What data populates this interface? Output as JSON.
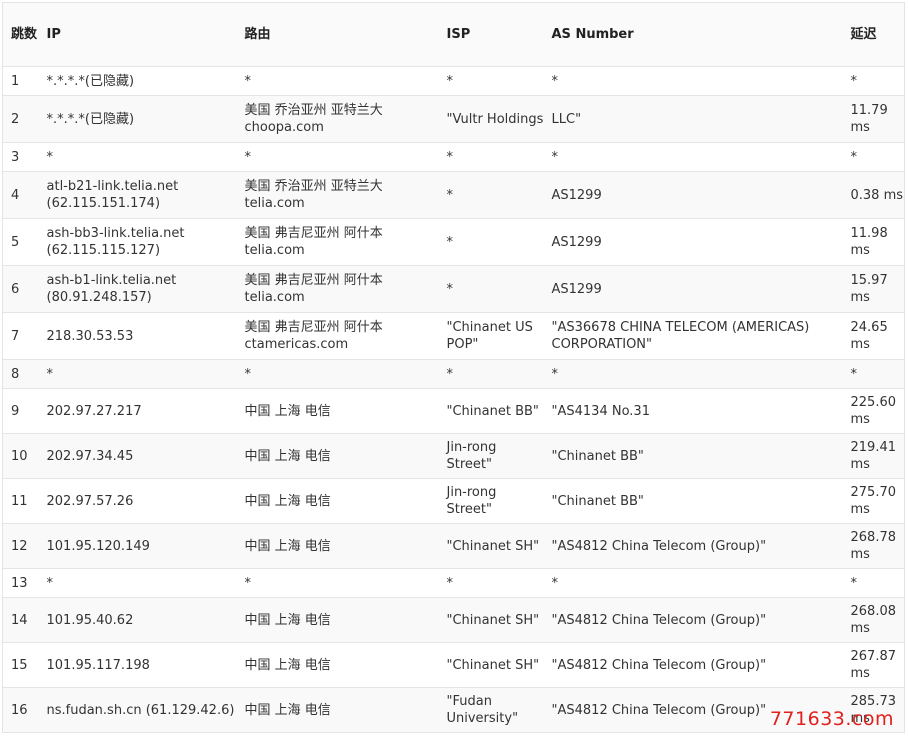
{
  "headers": {
    "hop": "跳数",
    "ip": "IP",
    "route": "路由",
    "isp": "ISP",
    "as": "AS Number",
    "latency": "延迟"
  },
  "rows": [
    {
      "hop": "1",
      "ip": "*.*.*.*(已隐藏)",
      "route": "*",
      "isp": "*",
      "as": "*",
      "latency": "*"
    },
    {
      "hop": "2",
      "ip": "*.*.*.*(已隐藏)",
      "route": "美国 乔治亚州 亚特兰大 choopa.com",
      "isp": "\"Vultr Holdings",
      "as": "LLC\"",
      "latency": "11.79 ms"
    },
    {
      "hop": "3",
      "ip": "*",
      "route": "*",
      "isp": "*",
      "as": "*",
      "latency": "*"
    },
    {
      "hop": "4",
      "ip": "atl-b21-link.telia.net (62.115.151.174)",
      "route": "美国 乔治亚州 亚特兰大 telia.com",
      "isp": "*",
      "as": "AS1299",
      "latency": "0.38 ms"
    },
    {
      "hop": "5",
      "ip": "ash-bb3-link.telia.net (62.115.115.127)",
      "route": "美国 弗吉尼亚州 阿什本 telia.com",
      "isp": "*",
      "as": "AS1299",
      "latency": "11.98 ms"
    },
    {
      "hop": "6",
      "ip": "ash-b1-link.telia.net (80.91.248.157)",
      "route": "美国 弗吉尼亚州 阿什本 telia.com",
      "isp": "*",
      "as": "AS1299",
      "latency": "15.97 ms"
    },
    {
      "hop": "7",
      "ip": "218.30.53.53",
      "route": "美国 弗吉尼亚州 阿什本 ctamericas.com",
      "isp": "\"Chinanet US POP\"",
      "as": "\"AS36678 CHINA TELECOM (AMERICAS) CORPORATION\"",
      "latency": "24.65 ms"
    },
    {
      "hop": "8",
      "ip": "*",
      "route": "*",
      "isp": "*",
      "as": "*",
      "latency": "*"
    },
    {
      "hop": "9",
      "ip": "202.97.27.217",
      "route": "中国 上海 电信",
      "isp": "\"Chinanet BB\"",
      "as": "\"AS4134 No.31",
      "latency": "225.60 ms"
    },
    {
      "hop": "10",
      "ip": "202.97.34.45",
      "route": "中国 上海 电信",
      "isp": "Jin-rong Street\"",
      "as": "\"Chinanet BB\"",
      "latency": "219.41 ms"
    },
    {
      "hop": "11",
      "ip": "202.97.57.26",
      "route": "中国 上海 电信",
      "isp": "Jin-rong Street\"",
      "as": "\"Chinanet BB\"",
      "latency": "275.70 ms"
    },
    {
      "hop": "12",
      "ip": "101.95.120.149",
      "route": "中国 上海 电信",
      "isp": "\"Chinanet SH\"",
      "as": "\"AS4812 China Telecom (Group)\"",
      "latency": "268.78 ms"
    },
    {
      "hop": "13",
      "ip": "*",
      "route": "*",
      "isp": "*",
      "as": "*",
      "latency": "*"
    },
    {
      "hop": "14",
      "ip": "101.95.40.62",
      "route": "中国 上海 电信",
      "isp": "\"Chinanet SH\"",
      "as": "\"AS4812 China Telecom (Group)\"",
      "latency": "268.08 ms"
    },
    {
      "hop": "15",
      "ip": "101.95.117.198",
      "route": "中国 上海 电信",
      "isp": "\"Chinanet SH\"",
      "as": "\"AS4812 China Telecom (Group)\"",
      "latency": "267.87 ms"
    },
    {
      "hop": "16",
      "ip": "ns.fudan.sh.cn (61.129.42.6)",
      "route": "中国 上海 电信",
      "isp": "\"Fudan University\"",
      "as": "\"AS4812 China Telecom (Group)\"",
      "latency": "285.73 ms"
    }
  ],
  "watermark": "771633.com",
  "colors": {
    "watermark": "#e0201c",
    "border": "#e4e4e4",
    "stripe": "#f9f9f9"
  }
}
